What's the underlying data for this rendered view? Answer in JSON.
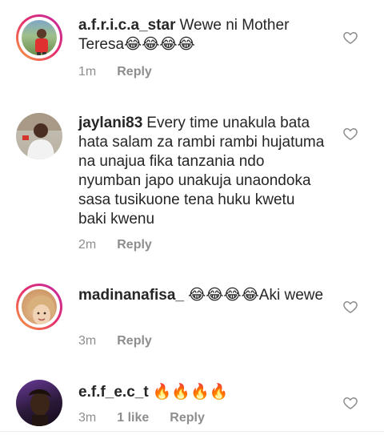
{
  "comments": [
    {
      "username": "a.f.r.i.c.a_star",
      "text": "Wewe ni Mother Teresa😂😂😂😂",
      "time": "1m",
      "likes": "",
      "reply": "Reply",
      "story_ring": true
    },
    {
      "username": "jaylani83",
      "text": "Every time unakula bata hata salam za rambi rambi hujatuma na unajua fika tanzania ndo nyumban japo unakuja unaondoka  sasa tusikuone tena huku kwetu baki kwenu",
      "time": "2m",
      "likes": "",
      "reply": "Reply",
      "story_ring": false
    },
    {
      "username": "madinanafisa_",
      "text": "😂😂😂😂Aki wewe",
      "time": "3m",
      "likes": "",
      "reply": "Reply",
      "story_ring": true
    },
    {
      "username": "e.f.f_e.c_t",
      "text": "🔥🔥🔥🔥",
      "time": "3m",
      "likes": "1 like",
      "reply": "Reply",
      "story_ring": false
    }
  ],
  "colors": {
    "text": "#262626",
    "secondary": "#8e8e8e",
    "ring_start": "#f9a43a",
    "ring_end": "#c22aa5"
  },
  "icons": {
    "like": "heart-outline-icon"
  }
}
